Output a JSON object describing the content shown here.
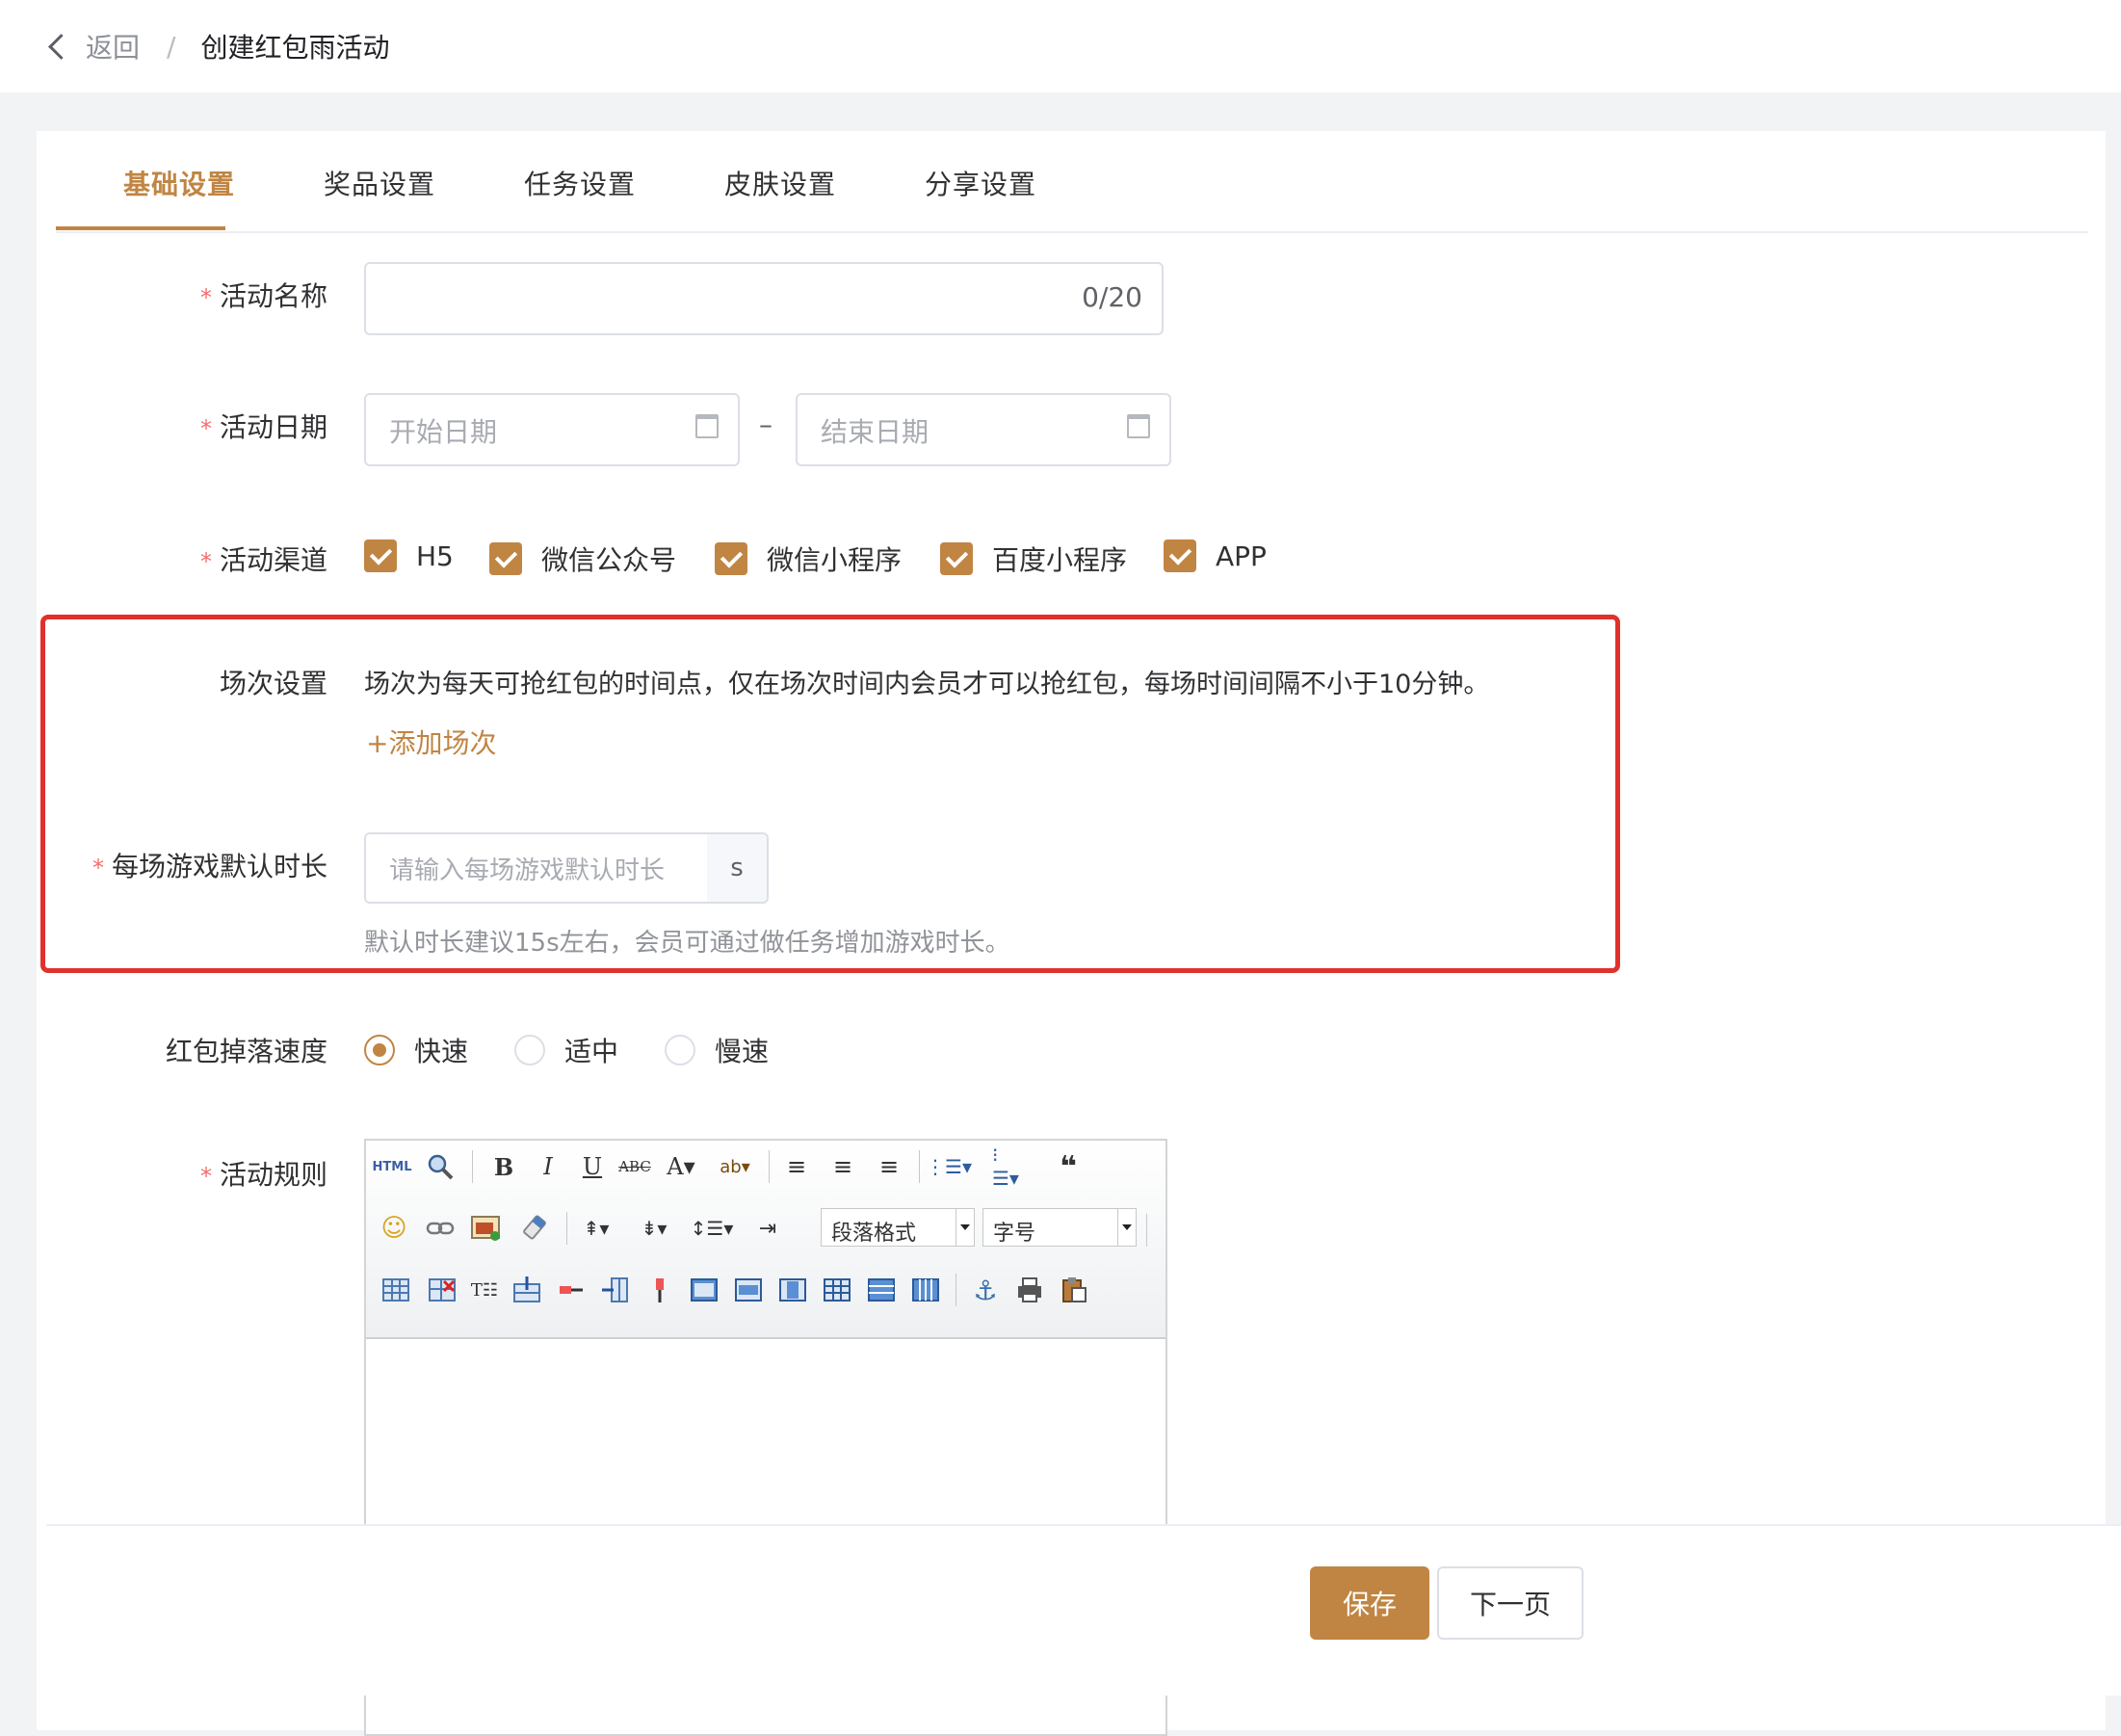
{
  "header": {
    "back_label": "返回",
    "separator": "/",
    "title": "创建红包雨活动"
  },
  "tabs": [
    {
      "label": "基础设置",
      "active": true
    },
    {
      "label": "奖品设置",
      "active": false
    },
    {
      "label": "任务设置",
      "active": false
    },
    {
      "label": "皮肤设置",
      "active": false
    },
    {
      "label": "分享设置",
      "active": false
    }
  ],
  "form": {
    "name": {
      "label": "活动名称",
      "counter": "0/20",
      "value": ""
    },
    "date": {
      "label": "活动日期",
      "start_placeholder": "开始日期",
      "range_separator": "–",
      "end_placeholder": "结束日期"
    },
    "channel": {
      "label": "活动渠道",
      "options": [
        {
          "label": "H5",
          "checked": true
        },
        {
          "label": "微信公众号",
          "checked": true
        },
        {
          "label": "微信小程序",
          "checked": true
        },
        {
          "label": "百度小程序",
          "checked": true
        },
        {
          "label": "APP",
          "checked": true
        }
      ]
    },
    "session": {
      "label": "场次设置",
      "description": "场次为每天可抢红包的时间点，仅在场次时间内会员才可以抢红包，每场时间间隔不小于10分钟。",
      "add_link": "+添加场次"
    },
    "duration": {
      "label": "每场游戏默认时长",
      "placeholder": "请输入每场游戏默认时长",
      "suffix": "s",
      "hint": "默认时长建议15s左右，会员可通过做任务增加游戏时长。"
    },
    "speed": {
      "label": "红包掉落速度",
      "options": [
        {
          "label": "快速",
          "selected": true
        },
        {
          "label": "适中",
          "selected": false
        },
        {
          "label": "慢速",
          "selected": false
        }
      ]
    },
    "rules": {
      "label": "活动规则",
      "paragraph_format": "段落格式",
      "font_size": "字号"
    }
  },
  "footer": {
    "save_label": "保存",
    "next_label": "下一页"
  },
  "colors": {
    "accent": "#c08543",
    "required": "#f56c6c",
    "highlight_border": "#e0312c"
  }
}
